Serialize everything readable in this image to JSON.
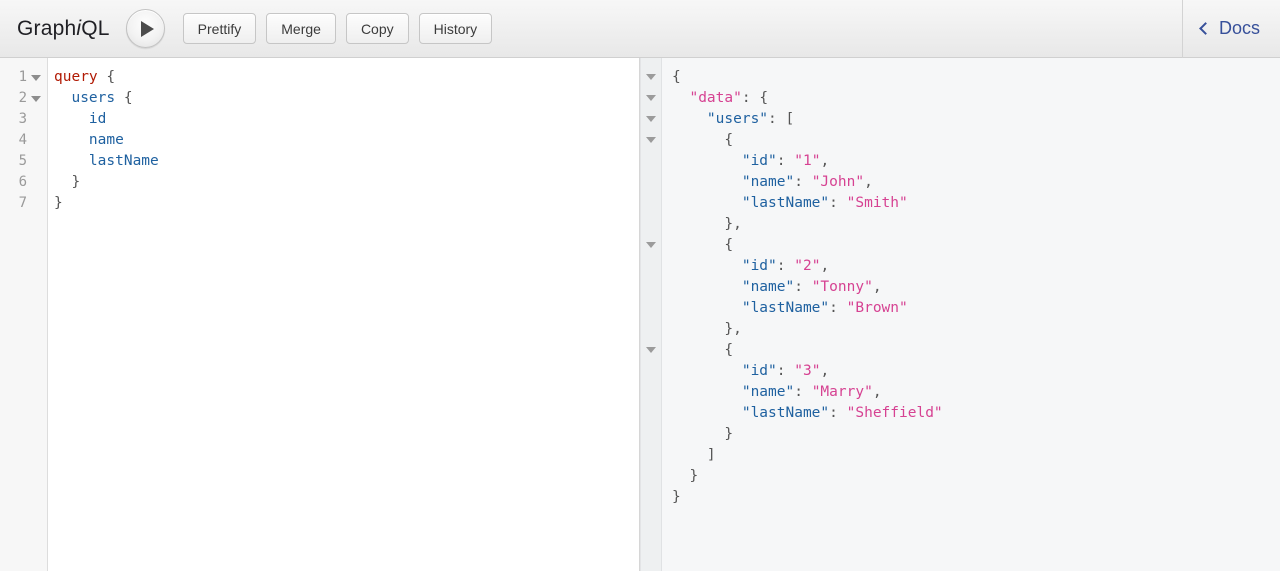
{
  "app": {
    "logo_prefix": "Graph",
    "logo_italic": "i",
    "logo_suffix": "QL"
  },
  "toolbar": {
    "execute_label": "Execute Query (Ctrl-Enter)",
    "execute_icon": "play-icon",
    "buttons": [
      {
        "label": "Prettify"
      },
      {
        "label": "Merge"
      },
      {
        "label": "Copy"
      },
      {
        "label": "History"
      }
    ],
    "docs": {
      "label": "Docs",
      "icon": "chevron-left-icon"
    }
  },
  "query_editor": {
    "line_numbers": [
      "1",
      "2",
      "3",
      "4",
      "5",
      "6",
      "7"
    ],
    "foldable_lines": [
      1,
      2
    ],
    "lines": [
      {
        "n": 1,
        "tokens": [
          {
            "t": "query",
            "c": "t-kw"
          },
          {
            "t": " ",
            "c": "t-punc"
          },
          {
            "t": "{",
            "c": "t-punc"
          }
        ]
      },
      {
        "n": 2,
        "tokens": [
          {
            "t": "  ",
            "c": "t-punc"
          },
          {
            "t": "users",
            "c": "t-field"
          },
          {
            "t": " ",
            "c": "t-punc"
          },
          {
            "t": "{",
            "c": "t-punc"
          }
        ]
      },
      {
        "n": 3,
        "tokens": [
          {
            "t": "    ",
            "c": "t-punc"
          },
          {
            "t": "id",
            "c": "t-field"
          }
        ]
      },
      {
        "n": 4,
        "tokens": [
          {
            "t": "    ",
            "c": "t-punc"
          },
          {
            "t": "name",
            "c": "t-field"
          }
        ]
      },
      {
        "n": 5,
        "tokens": [
          {
            "t": "    ",
            "c": "t-punc"
          },
          {
            "t": "lastName",
            "c": "t-field"
          }
        ]
      },
      {
        "n": 6,
        "tokens": [
          {
            "t": "  ",
            "c": "t-punc"
          },
          {
            "t": "}",
            "c": "t-punc"
          }
        ]
      },
      {
        "n": 7,
        "tokens": [
          {
            "t": "}",
            "c": "t-punc"
          }
        ]
      }
    ],
    "raw_text": "query {\n  users {\n    id\n    name\n    lastName\n  }\n}"
  },
  "result_panel": {
    "fold_caret_line_indices": [
      0,
      1,
      2,
      3,
      8,
      13
    ],
    "response": {
      "data": {
        "users": [
          {
            "id": "1",
            "name": "John",
            "lastName": "Smith"
          },
          {
            "id": "2",
            "name": "Tonny",
            "lastName": "Brown"
          },
          {
            "id": "3",
            "name": "Marry",
            "lastName": "Sheffield"
          }
        ]
      }
    },
    "lines": [
      [
        {
          "t": "{",
          "c": "t-brace"
        }
      ],
      [
        {
          "t": "  ",
          "c": "t-brace"
        },
        {
          "t": "\"data\"",
          "c": "t-key-data"
        },
        {
          "t": ": {",
          "c": "t-brace"
        }
      ],
      [
        {
          "t": "    ",
          "c": "t-brace"
        },
        {
          "t": "\"users\"",
          "c": "t-key"
        },
        {
          "t": ": [",
          "c": "t-brace"
        }
      ],
      [
        {
          "t": "      {",
          "c": "t-brace"
        }
      ],
      [
        {
          "t": "        ",
          "c": "t-brace"
        },
        {
          "t": "\"id\"",
          "c": "t-key"
        },
        {
          "t": ": ",
          "c": "t-brace"
        },
        {
          "t": "\"1\"",
          "c": "t-str"
        },
        {
          "t": ",",
          "c": "t-brace"
        }
      ],
      [
        {
          "t": "        ",
          "c": "t-brace"
        },
        {
          "t": "\"name\"",
          "c": "t-key"
        },
        {
          "t": ": ",
          "c": "t-brace"
        },
        {
          "t": "\"John\"",
          "c": "t-str"
        },
        {
          "t": ",",
          "c": "t-brace"
        }
      ],
      [
        {
          "t": "        ",
          "c": "t-brace"
        },
        {
          "t": "\"lastName\"",
          "c": "t-key"
        },
        {
          "t": ": ",
          "c": "t-brace"
        },
        {
          "t": "\"Smith\"",
          "c": "t-str"
        }
      ],
      [
        {
          "t": "      },",
          "c": "t-brace"
        }
      ],
      [
        {
          "t": "      {",
          "c": "t-brace"
        }
      ],
      [
        {
          "t": "        ",
          "c": "t-brace"
        },
        {
          "t": "\"id\"",
          "c": "t-key"
        },
        {
          "t": ": ",
          "c": "t-brace"
        },
        {
          "t": "\"2\"",
          "c": "t-str"
        },
        {
          "t": ",",
          "c": "t-brace"
        }
      ],
      [
        {
          "t": "        ",
          "c": "t-brace"
        },
        {
          "t": "\"name\"",
          "c": "t-key"
        },
        {
          "t": ": ",
          "c": "t-brace"
        },
        {
          "t": "\"Tonny\"",
          "c": "t-str"
        },
        {
          "t": ",",
          "c": "t-brace"
        }
      ],
      [
        {
          "t": "        ",
          "c": "t-brace"
        },
        {
          "t": "\"lastName\"",
          "c": "t-key"
        },
        {
          "t": ": ",
          "c": "t-brace"
        },
        {
          "t": "\"Brown\"",
          "c": "t-str"
        }
      ],
      [
        {
          "t": "      },",
          "c": "t-brace"
        }
      ],
      [
        {
          "t": "      {",
          "c": "t-brace"
        }
      ],
      [
        {
          "t": "        ",
          "c": "t-brace"
        },
        {
          "t": "\"id\"",
          "c": "t-key"
        },
        {
          "t": ": ",
          "c": "t-brace"
        },
        {
          "t": "\"3\"",
          "c": "t-str"
        },
        {
          "t": ",",
          "c": "t-brace"
        }
      ],
      [
        {
          "t": "        ",
          "c": "t-brace"
        },
        {
          "t": "\"name\"",
          "c": "t-key"
        },
        {
          "t": ": ",
          "c": "t-brace"
        },
        {
          "t": "\"Marry\"",
          "c": "t-str"
        },
        {
          "t": ",",
          "c": "t-brace"
        }
      ],
      [
        {
          "t": "        ",
          "c": "t-brace"
        },
        {
          "t": "\"lastName\"",
          "c": "t-key"
        },
        {
          "t": ": ",
          "c": "t-brace"
        },
        {
          "t": "\"Sheffield\"",
          "c": "t-str"
        }
      ],
      [
        {
          "t": "      }",
          "c": "t-brace"
        }
      ],
      [
        {
          "t": "    ]",
          "c": "t-brace"
        }
      ],
      [
        {
          "t": "  }",
          "c": "t-brace"
        }
      ],
      [
        {
          "t": "}",
          "c": "t-brace"
        }
      ]
    ]
  },
  "colors": {
    "keyword": "#b11a04",
    "field": "#1f61a0",
    "json_key": "#1f61a0",
    "json_key_data": "#d64292",
    "json_string": "#d64292",
    "docs_link": "#37509a",
    "result_bg": "#f6f7f8",
    "editor_bg": "#ffffff"
  }
}
